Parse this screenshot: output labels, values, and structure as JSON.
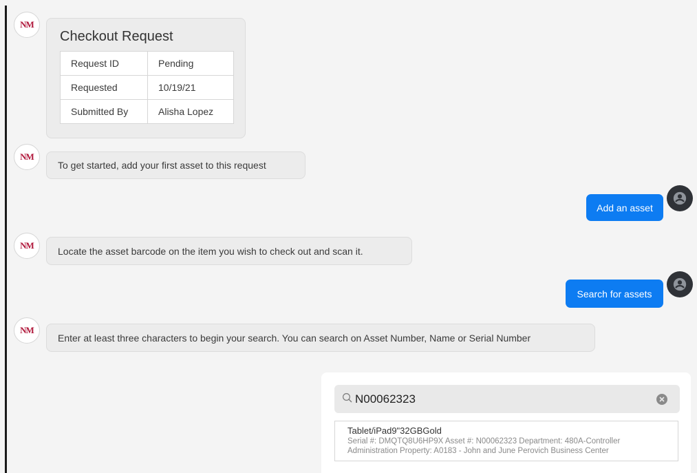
{
  "bot": {
    "logo_text": "NM"
  },
  "checkout_card": {
    "title": "Checkout Request",
    "rows": [
      {
        "label": "Request ID",
        "value": "Pending"
      },
      {
        "label": "Requested",
        "value": "10/19/21"
      },
      {
        "label": "Submitted By",
        "value": "Alisha Lopez"
      }
    ]
  },
  "messages": {
    "bot_1": "To get started, add your first asset to this request",
    "user_1": "Add an asset",
    "bot_2": "Locate the asset barcode on the item you wish to check out and scan it.",
    "user_2": "Search for assets",
    "bot_3": "Enter at least three characters to begin your search. You can search on Asset Number, Name or Serial Number"
  },
  "search": {
    "value": "N00062323",
    "icon": "search-icon",
    "clear_icon": "close-circle-icon"
  },
  "results": [
    {
      "name": "Tablet/iPad9\"32GBGold",
      "meta_line1": "Serial #: DMQTQ8U6HP9X Asset #: N00062323 Department: 480A-Controller",
      "meta_line2": "Administration Property: A0183 - John and June Perovich Business Center"
    }
  ],
  "colors": {
    "user_bubble": "#0d7cf2",
    "bot_bubble": "#ececec",
    "logo_red": "#b0173a",
    "user_avatar": "#2f3237"
  }
}
